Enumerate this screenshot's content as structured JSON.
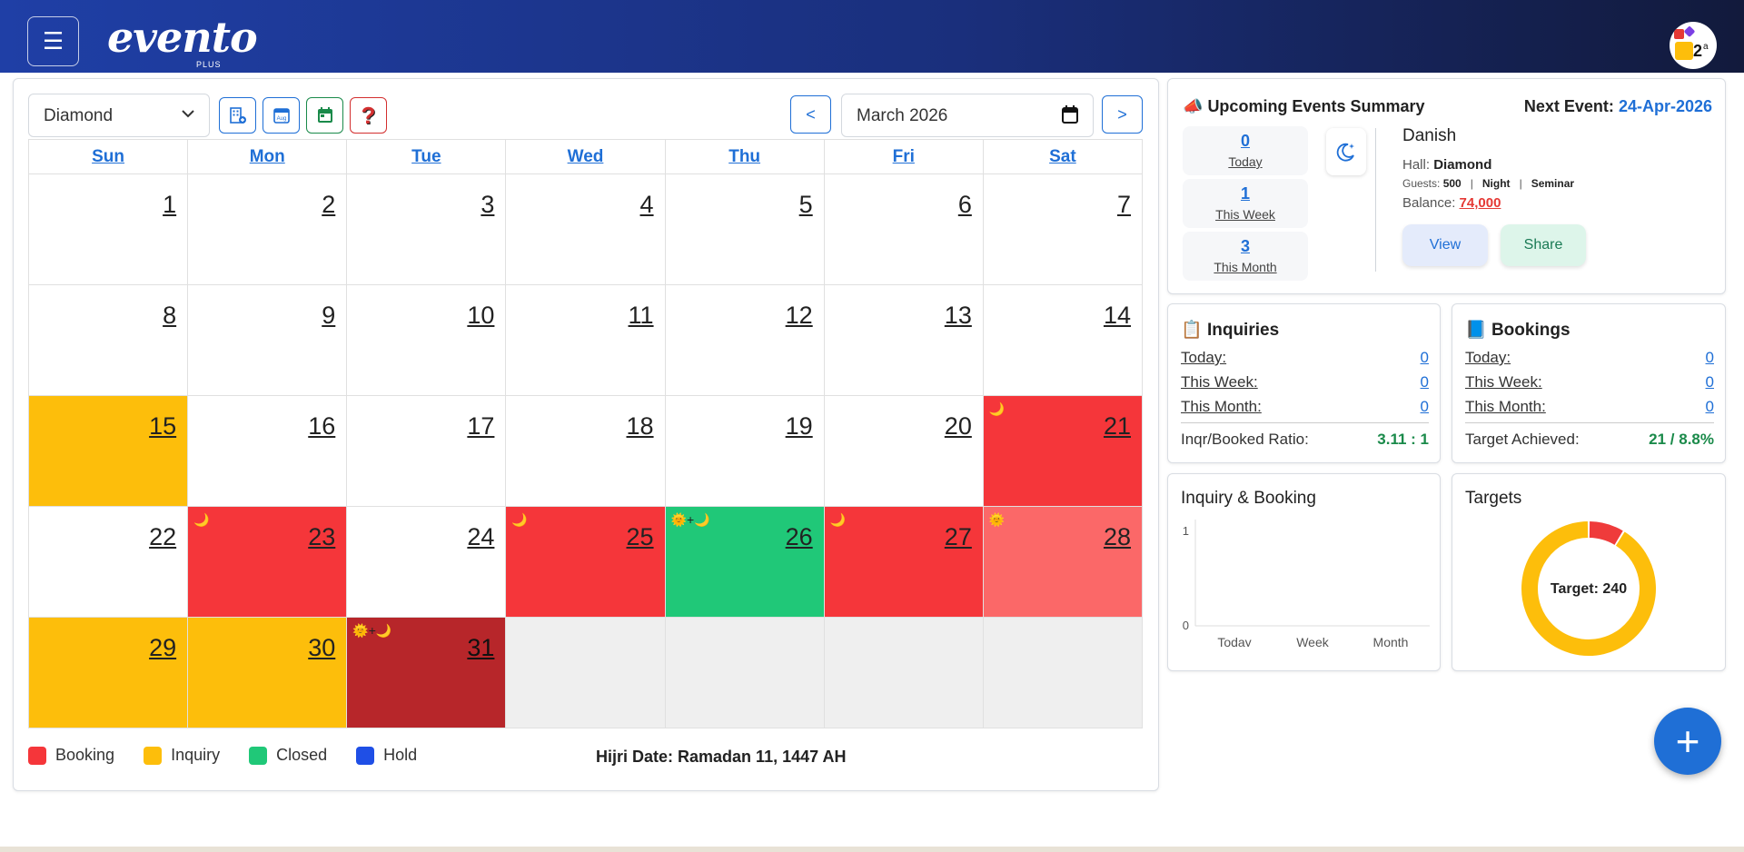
{
  "header": {
    "logo_text": "evento",
    "logo_sub": "PLUS",
    "menu_icon": "☰"
  },
  "toolbar": {
    "hall_selected": "Diamond",
    "month_value": "March 2026",
    "prev_label": "<",
    "next_label": ">",
    "help_label": "?",
    "aug_icon_label": "Aug"
  },
  "calendar": {
    "weekdays": [
      "Sun",
      "Mon",
      "Tue",
      "Wed",
      "Thu",
      "Fri",
      "Sat"
    ],
    "weeks": [
      [
        {
          "d": "1"
        },
        {
          "d": "2"
        },
        {
          "d": "3"
        },
        {
          "d": "4"
        },
        {
          "d": "5"
        },
        {
          "d": "6"
        },
        {
          "d": "7"
        }
      ],
      [
        {
          "d": "8"
        },
        {
          "d": "9"
        },
        {
          "d": "10"
        },
        {
          "d": "11"
        },
        {
          "d": "12"
        },
        {
          "d": "13"
        },
        {
          "d": "14"
        }
      ],
      [
        {
          "d": "15",
          "status": "inquiry"
        },
        {
          "d": "16"
        },
        {
          "d": "17"
        },
        {
          "d": "18"
        },
        {
          "d": "19"
        },
        {
          "d": "20"
        },
        {
          "d": "21",
          "status": "booking",
          "marks": "🌙"
        }
      ],
      [
        {
          "d": "22"
        },
        {
          "d": "23",
          "status": "booking",
          "marks": "🌙"
        },
        {
          "d": "24"
        },
        {
          "d": "25",
          "status": "booking",
          "marks": "🌙"
        },
        {
          "d": "26",
          "status": "closed",
          "marks": "🌞+🌙"
        },
        {
          "d": "27",
          "status": "booking",
          "marks": "🌙"
        },
        {
          "d": "28",
          "status": "booking-light",
          "marks": "🌞"
        }
      ],
      [
        {
          "d": "29",
          "status": "inquiry"
        },
        {
          "d": "30",
          "status": "inquiry"
        },
        {
          "d": "31",
          "status": "booking-dark",
          "marks": "🌞+🌙"
        },
        {
          "d": ""
        },
        {
          "d": ""
        },
        {
          "d": ""
        },
        {
          "d": ""
        }
      ]
    ],
    "status_colors": {
      "inquiry": "#fdbe0b",
      "booking": "#f5363a",
      "booking-light": "#fb6868",
      "booking-dark": "#b7262a",
      "closed": "#20c878"
    }
  },
  "legend": [
    {
      "label": "Booking",
      "color": "#f5363a"
    },
    {
      "label": "Inquiry",
      "color": "#fdbe0b"
    },
    {
      "label": "Closed",
      "color": "#20c878"
    },
    {
      "label": "Hold",
      "color": "#1f4fe6"
    }
  ],
  "hijri": "Hijri Date: Ramadan 11, 1447 AH",
  "upcoming": {
    "title": "Upcoming Events Summary",
    "next_event_label": "Next Event:",
    "next_event_date": "24-Apr-2026",
    "stats": [
      {
        "count": "0",
        "label": "Today"
      },
      {
        "count": "1",
        "label": "This Week"
      },
      {
        "count": "3",
        "label": "This Month"
      }
    ],
    "event": {
      "name": "Danish",
      "hall_label": "Hall:",
      "hall": "Diamond",
      "guests_label": "Guests:",
      "guests": "500",
      "sep": "|",
      "time": "Night",
      "type": "Seminar",
      "balance_label": "Balance:",
      "balance": "74,000"
    },
    "view_label": "View",
    "share_label": "Share"
  },
  "inquiries": {
    "title": "Inquiries",
    "rows": [
      {
        "label": "Today:",
        "value": "0"
      },
      {
        "label": "This Week:",
        "value": "0"
      },
      {
        "label": "This Month:",
        "value": "0"
      }
    ],
    "summary_label": "Inqr/Booked Ratio:",
    "summary_value": "3.11 : 1"
  },
  "bookings": {
    "title": "Bookings",
    "rows": [
      {
        "label": "Today:",
        "value": "0"
      },
      {
        "label": "This Week:",
        "value": "0"
      },
      {
        "label": "This Month:",
        "value": "0"
      }
    ],
    "summary_label": "Target Achieved:",
    "summary_value": "21 / 8.8%"
  },
  "inquiry_booking_chart": {
    "title": "Inquiry & Booking",
    "chart_data": {
      "type": "bar",
      "categories": [
        "Today",
        "Week",
        "Month"
      ],
      "series": [],
      "ylim": [
        0,
        1
      ],
      "yticks": [
        "1",
        "0"
      ]
    }
  },
  "targets_chart": {
    "title": "Targets",
    "center_label": "Target: 240",
    "chart_data": {
      "type": "pie",
      "slices": [
        {
          "value": 21,
          "color": "#ef3b3b"
        },
        {
          "value": 219,
          "color": "#fdbe0b"
        }
      ]
    }
  },
  "fab_label": "+"
}
